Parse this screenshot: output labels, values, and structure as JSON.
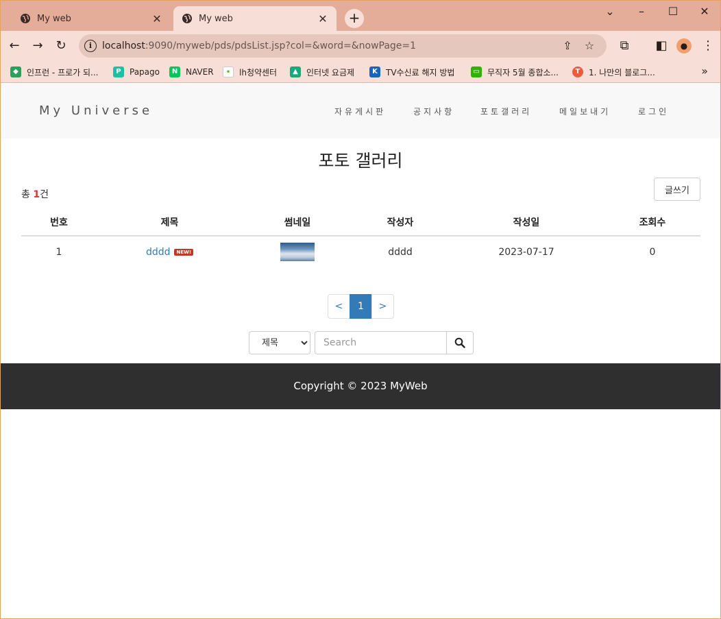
{
  "browser": {
    "tabs": [
      {
        "title": "My web",
        "active": false
      },
      {
        "title": "My web",
        "active": true
      }
    ],
    "new_tab": "+",
    "url_host": "localhost",
    "url_path": ":9090/myweb/pds/pdsList.jsp?col=&word=&nowPage=1",
    "bookmarks": [
      {
        "label": "인프런 - 프로가 되...",
        "icon": "inflearn-icon",
        "color": "#2e9e5b"
      },
      {
        "label": "Papago",
        "icon": "papago-icon",
        "color": "#1ec0a5"
      },
      {
        "label": "NAVER",
        "icon": "naver-icon",
        "color": "#03c75a"
      },
      {
        "label": "lh청약센터",
        "icon": "lh-icon",
        "color": "#5cb531"
      },
      {
        "label": "인터넷 요금제",
        "icon": "mortarboard-icon",
        "color": "#1aa87a"
      },
      {
        "label": "TV수신료 해지 방법",
        "icon": "kbs-icon",
        "color": "#1565c0"
      },
      {
        "label": "무직자 5월 종합소...",
        "icon": "message-icon",
        "color": "#2db400"
      },
      {
        "label": "1. 나만의 블로그...",
        "icon": "tistory-icon",
        "color": "#ef5a3a"
      }
    ],
    "more": "»"
  },
  "site": {
    "brand": "My Universe",
    "menu": [
      "자유게시판",
      "공지사항",
      "포토갤러리",
      "메일보내기",
      "로그인"
    ]
  },
  "main": {
    "title": "포토 갤러리",
    "total_prefix": "총 ",
    "total_count": "1",
    "total_suffix": "건",
    "write_label": "글쓰기",
    "columns": [
      "번호",
      "제목",
      "썸네일",
      "작성자",
      "작성일",
      "조회수"
    ],
    "rows": [
      {
        "no": "1",
        "title": "dddd",
        "badge": "NEW!",
        "writer": "dddd",
        "date": "2023-07-17",
        "views": "0"
      }
    ],
    "pager": {
      "prev": "<",
      "current": "1",
      "next": ">"
    },
    "search": {
      "selected": "제목",
      "placeholder": "Search"
    }
  },
  "footer": {
    "text": "Copyright © 2023 MyWeb"
  }
}
